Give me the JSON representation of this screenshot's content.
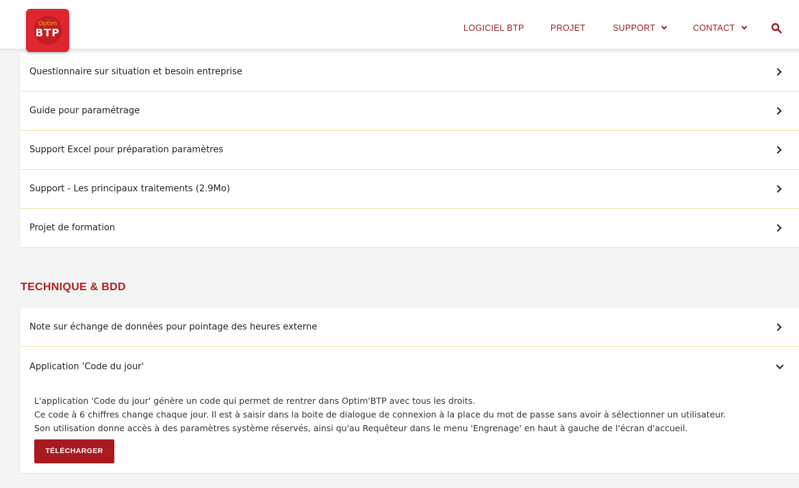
{
  "logo": {
    "small_text": "Optim",
    "big_text": "BTP"
  },
  "nav": {
    "items": [
      {
        "label": "LOGICIEL BTP",
        "has_dropdown": false
      },
      {
        "label": "PROJET",
        "has_dropdown": false
      },
      {
        "label": "SUPPORT",
        "has_dropdown": true
      },
      {
        "label": "CONTACT",
        "has_dropdown": true
      }
    ],
    "search_icon": "search-icon"
  },
  "formation_list": [
    {
      "label": "Questionnaire sur situation et besoin entreprise"
    },
    {
      "label": "Guide pour paramétrage"
    },
    {
      "label": "Support Excel pour préparation paramètres"
    },
    {
      "label": "Support - Les principaux traitements (2.9Mo)"
    },
    {
      "label": "Projet de formation"
    }
  ],
  "technique": {
    "title": "TECHNIQUE & BDD",
    "items": [
      {
        "label": "Note sur échange de données pour pointage des heures externe",
        "expanded": false
      },
      {
        "label": "Application 'Code du jour'",
        "expanded": true
      }
    ],
    "expanded_content": {
      "lines": [
        "L'application 'Code du jour' génère un code qui permet de rentrer dans Optim'BTP avec tous les droits.",
        "Ce code à 6 chiffres change chaque jour. Il est à saisir dans la boite de dialogue de connexion à la place du mot de passe sans avoir à sélectionner un utilisateur.",
        "Son utilisation donne accès à des paramètres système réservés, ainsi qu'au Requêteur dans le menu 'Engrenage' en haut à gauche de l'écran d'accueil."
      ],
      "button_label": "TÉLÉCHARGER"
    }
  },
  "colors": {
    "brand_red": "#a81920",
    "nav_red": "#9a1b20",
    "divider_yellow": "#f1e3a6",
    "background": "#f4f4f4"
  }
}
